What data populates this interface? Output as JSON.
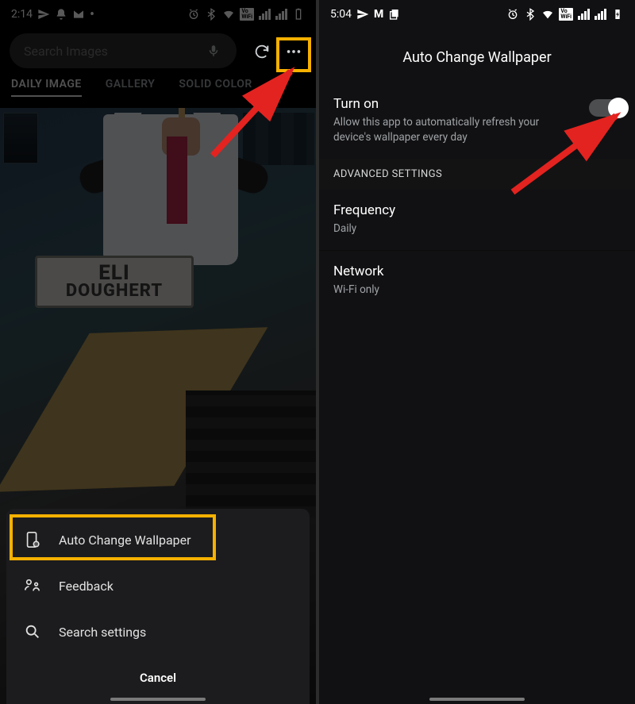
{
  "left": {
    "status": {
      "time": "2:14"
    },
    "search": {
      "placeholder": "Search Images"
    },
    "tabs": [
      "DAILY IMAGE",
      "GALLERY",
      "SOLID COLOR"
    ],
    "sign_text": "ELI\nDOUGHERT",
    "sheet": {
      "items": [
        {
          "icon": "wallpaper-gear-icon",
          "label": "Auto Change Wallpaper"
        },
        {
          "icon": "feedback-icon",
          "label": "Feedback"
        },
        {
          "icon": "search-icon",
          "label": "Search settings"
        }
      ],
      "cancel": "Cancel"
    }
  },
  "right": {
    "status": {
      "time": "5:04"
    },
    "title": "Auto Change Wallpaper",
    "turn_on": {
      "title": "Turn on",
      "subtitle": "Allow this app to automatically refresh your device's wallpaper every day",
      "value": true
    },
    "section": "ADVANCED SETTINGS",
    "frequency": {
      "title": "Frequency",
      "value": "Daily"
    },
    "network": {
      "title": "Network",
      "value": "Wi-Fi only"
    }
  }
}
